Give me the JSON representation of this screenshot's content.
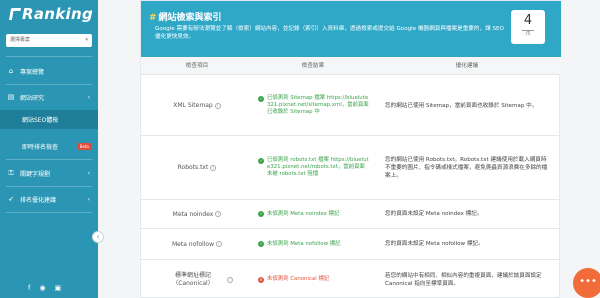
{
  "app": {
    "logo_text": "Ranking"
  },
  "project_select": {
    "label": "選擇專案"
  },
  "sidebar": {
    "items": [
      {
        "label": "專案總覽"
      },
      {
        "label": "網站研究"
      },
      {
        "label": "網站SEO體檢"
      },
      {
        "label": "即時排名檢查",
        "badge": "Beta"
      },
      {
        "label": "關鍵字規劃"
      },
      {
        "label": "排名優化建議"
      }
    ]
  },
  "section": {
    "title": "網站檢索與索引",
    "description": "Google 需要有辦法瀏覽並了解（檢索）網站內容，並記錄（索引）入資料庫，透過檢索或提交給 Google 機器網頁與檔案是重要的，讓 SEO 優化更快見效。",
    "score": "4",
    "score_total": "/5"
  },
  "table": {
    "headers": [
      "檢查項目",
      "檢查結果",
      "優化建議"
    ],
    "rows": [
      {
        "item": "XML Sitemap",
        "status": "ok",
        "result": "已偵測到 Sitemap 檔案 https://bluelute321.pixnet.net/sitemap.xml，當前頁面已收錄於 Sitemap 中",
        "advice": "您的網站已使用 Sitemap，當前頁面也收錄於 Sitemap 中。"
      },
      {
        "item": "Robots.txt",
        "status": "ok",
        "result": "已偵測到 robots.txt 檔案 https://bluelute321.pixnet.net/robots.txt，當前頁面未被 robots.txt 阻擋",
        "advice": "您的網站已使用 Robots.txt。Robots.txt 建議使用於載入網頁時不重要的圖片、指令碼或樣式檔案，避免爬蟲資源浪費在多餘的檔案上。"
      },
      {
        "item": "Meta noindex",
        "status": "ok",
        "result": "未偵測到 Meta noindex 標記",
        "advice": "您的頁面未設定 Meta noindex 標記。"
      },
      {
        "item": "Meta nofollow",
        "status": "ok",
        "result": "未偵測到 Meta nofollow 標記",
        "advice": "您的頁面未設定 Meta nofollow 標記。"
      },
      {
        "item": "標準網址標記（Canonical）",
        "status": "bad",
        "result": "未偵測到 Canonical 標記",
        "advice": "若您的網站中有相同、相似內容的重複頁面，建議於該頁面設定 Canonical 指向至標準頁面。"
      }
    ]
  },
  "colors": {
    "sidebar": "#2a96b4",
    "header": "#2fa8c8",
    "ok": "#3aa34a",
    "bad": "#e0533f",
    "fab": "#f26b3a"
  }
}
